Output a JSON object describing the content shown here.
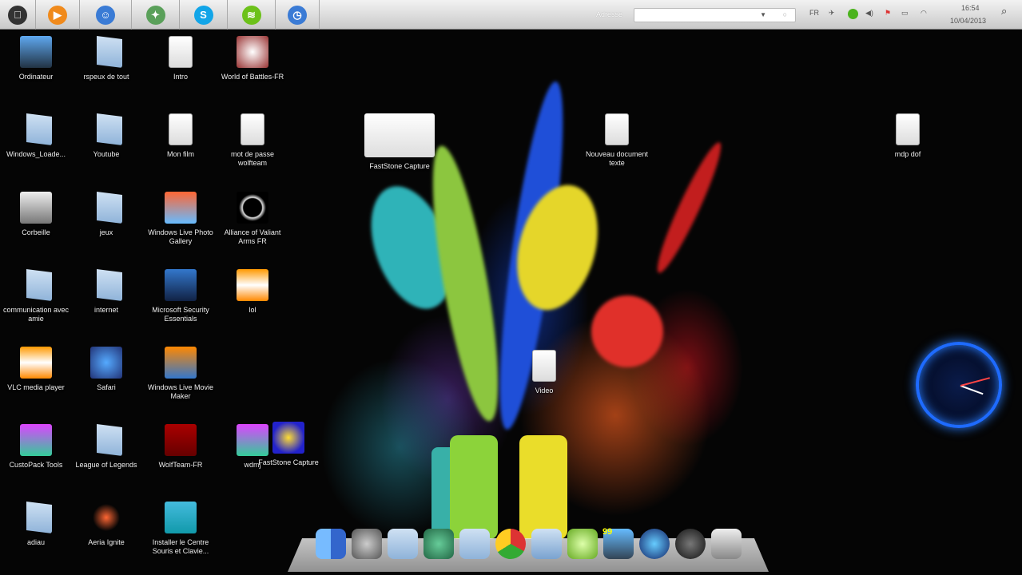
{
  "menubar": {
    "apps": [
      {
        "name": "apple-icon",
        "glyph": "",
        "color": "#333"
      },
      {
        "name": "media-player-icon",
        "glyph": "▶",
        "color": "#f08a1c"
      },
      {
        "name": "finder-icon",
        "glyph": "☺",
        "color": "#3a7bd5"
      },
      {
        "name": "maps-icon",
        "glyph": "✦",
        "color": "#5aa05a"
      },
      {
        "name": "skype-icon",
        "glyph": "S",
        "color": "#12a5e8"
      },
      {
        "name": "spotify-icon",
        "glyph": "≋",
        "color": "#6cc11a"
      },
      {
        "name": "clock-app-icon",
        "glyph": "◷",
        "color": "#3a7bd5"
      }
    ],
    "address_label": "Adresse",
    "address_value": "",
    "tray": {
      "lang": "FR"
    },
    "time": "16:54",
    "date": "10/04/2013"
  },
  "desktop_icons": [
    {
      "label": "Ordinateur",
      "type": "monitor"
    },
    {
      "label": "rspeux de tout",
      "type": "folder"
    },
    {
      "label": "Intro",
      "type": "doc"
    },
    {
      "label": "World of Battles-FR",
      "type": "game"
    },
    {
      "label": "Windows_Loade...",
      "type": "folder"
    },
    {
      "label": "Youtube",
      "type": "folder"
    },
    {
      "label": "Mon film",
      "type": "doc"
    },
    {
      "label": "mot de passe wolfteam",
      "type": "doc"
    },
    {
      "label": "Corbeille",
      "type": "trash"
    },
    {
      "label": "jeux",
      "type": "folder"
    },
    {
      "label": "Windows Live Photo Gallery",
      "type": "photo"
    },
    {
      "label": "Alliance of Valiant Arms FR",
      "type": "ava"
    },
    {
      "label": "communication avec amie",
      "type": "folder"
    },
    {
      "label": "internet",
      "type": "folder"
    },
    {
      "label": "Microsoft Security Essentials",
      "type": "mse"
    },
    {
      "label": "lol",
      "type": "vlc"
    },
    {
      "label": "VLC media player",
      "type": "vlc"
    },
    {
      "label": "Safari",
      "type": "safari"
    },
    {
      "label": "Windows Live Movie Maker",
      "type": "movie"
    },
    {
      "label": "CustoPack Tools",
      "type": "custo"
    },
    {
      "label": "League of Legends",
      "type": "folder"
    },
    {
      "label": "WolfTeam-FR",
      "type": "wolf"
    },
    {
      "label": "wdmj",
      "type": "custo"
    },
    {
      "label": "FastStone Capture",
      "type": "capture"
    },
    {
      "label": "adiau",
      "type": "folder"
    },
    {
      "label": "Aeria Ignite",
      "type": "aeria"
    },
    {
      "label": "Installer le Centre Souris et Clavie...",
      "type": "mouse"
    },
    {
      "label": "FastStone Capture",
      "type": "capture2"
    },
    {
      "label": "Nouveau document texte",
      "type": "doc"
    },
    {
      "label": "mdp dof",
      "type": "doc"
    },
    {
      "label": "Video",
      "type": "doc"
    }
  ],
  "dock": {
    "badge": "99",
    "items": [
      "finder",
      "system-preferences",
      "folder",
      "messenger",
      "folder",
      "chrome",
      "music-folder",
      "aeria",
      "monitor",
      "itunes",
      "dashboard",
      "trash"
    ]
  },
  "colors": {
    "menubar": "#dcdcdc",
    "clock_ring": "#1e6bff"
  }
}
